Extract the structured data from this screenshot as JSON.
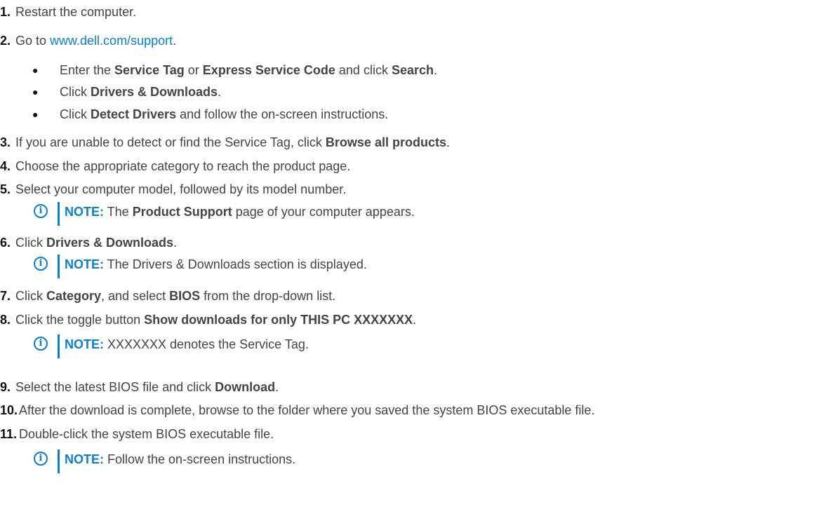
{
  "steps": [
    {
      "num": "1.",
      "text": "Restart the computer."
    },
    {
      "num": "2.",
      "pre": "Go to ",
      "link": "www.dell.com/support",
      "post": "."
    },
    {
      "num": "3.",
      "pre": "If you are unable to detect or find the Service Tag, click ",
      "bold": "Browse all products",
      "post": "."
    },
    {
      "num": "4.",
      "text": "Choose the appropriate category to reach the product page."
    },
    {
      "num": "5.",
      "text": "Select your computer model, followed by its model number."
    },
    {
      "num": "6.",
      "pre": "Click ",
      "bold": "Drivers & Downloads",
      "post": "."
    },
    {
      "num": "7.",
      "pre": "Click ",
      "bold": "Category",
      "mid": ", and select ",
      "bold2": "BIOS",
      "post": " from the drop-down list."
    },
    {
      "num": "8.",
      "pre": "Click the toggle button ",
      "bold": "Show downloads for only THIS PC XXXXXXX",
      "post": "."
    },
    {
      "num": "9.",
      "pre": "Select the latest BIOS file and click ",
      "bold": "Download",
      "post": "."
    },
    {
      "num": "10.",
      "text": "After the download is complete, browse to the folder where you saved the system BIOS executable file."
    },
    {
      "num": "11.",
      "text": "Double-click the system BIOS executable file."
    }
  ],
  "substeps": [
    {
      "bullet": "●",
      "pre": "Enter the ",
      "bold": "Service Tag",
      "mid": " or ",
      "bold2": "Express Service Code",
      "mid2": " and click ",
      "bold3": "Search",
      "post": "."
    },
    {
      "bullet": "●",
      "pre": "Click ",
      "bold": "Drivers & Downloads",
      "post": "."
    },
    {
      "bullet": "●",
      "pre": "Click ",
      "bold": "Detect Drivers",
      "post": " and follow the on-screen instructions."
    }
  ],
  "notes": [
    {
      "label": "NOTE:",
      "pre": " The ",
      "bold": "Product Support",
      "post": " page of your computer appears."
    },
    {
      "label": "NOTE:",
      "text": " The Drivers & Downloads section is displayed."
    },
    {
      "label": "NOTE:",
      "text": " XXXXXXX denotes the Service Tag."
    },
    {
      "label": "NOTE:",
      "text": " Follow the on-screen instructions."
    }
  ],
  "note_icon": "info-icon",
  "colors": {
    "accent": "#0a7fd0",
    "text": "#444444",
    "number": "#111111"
  }
}
